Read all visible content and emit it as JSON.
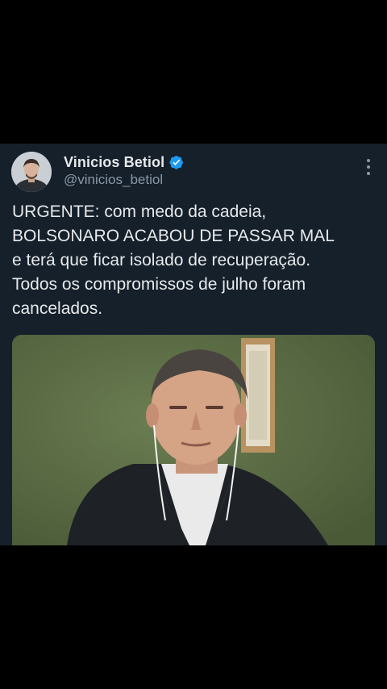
{
  "tweet": {
    "author": {
      "display_name": "Vinicios Betiol",
      "handle": "@vinicios_betiol",
      "verified": true,
      "avatar": "user-avatar"
    },
    "more_icon": "more-vertical-icon",
    "text": "URGENTE: com medo da cadeia,\nBOLSONARO ACABOU DE PASSAR MAL\ne terá que ficar isolado de recuperação.\nTodos os compromissos de julho foram\ncancelados.",
    "media": "video-frame-man-in-suit-with-earphones"
  },
  "colors": {
    "background": "#000000",
    "card": "#15202b",
    "primary_text": "#e7e9ea",
    "secondary_text": "#8b98a5",
    "verified": "#1d9bf0",
    "media_wall": "#5d6e47"
  }
}
